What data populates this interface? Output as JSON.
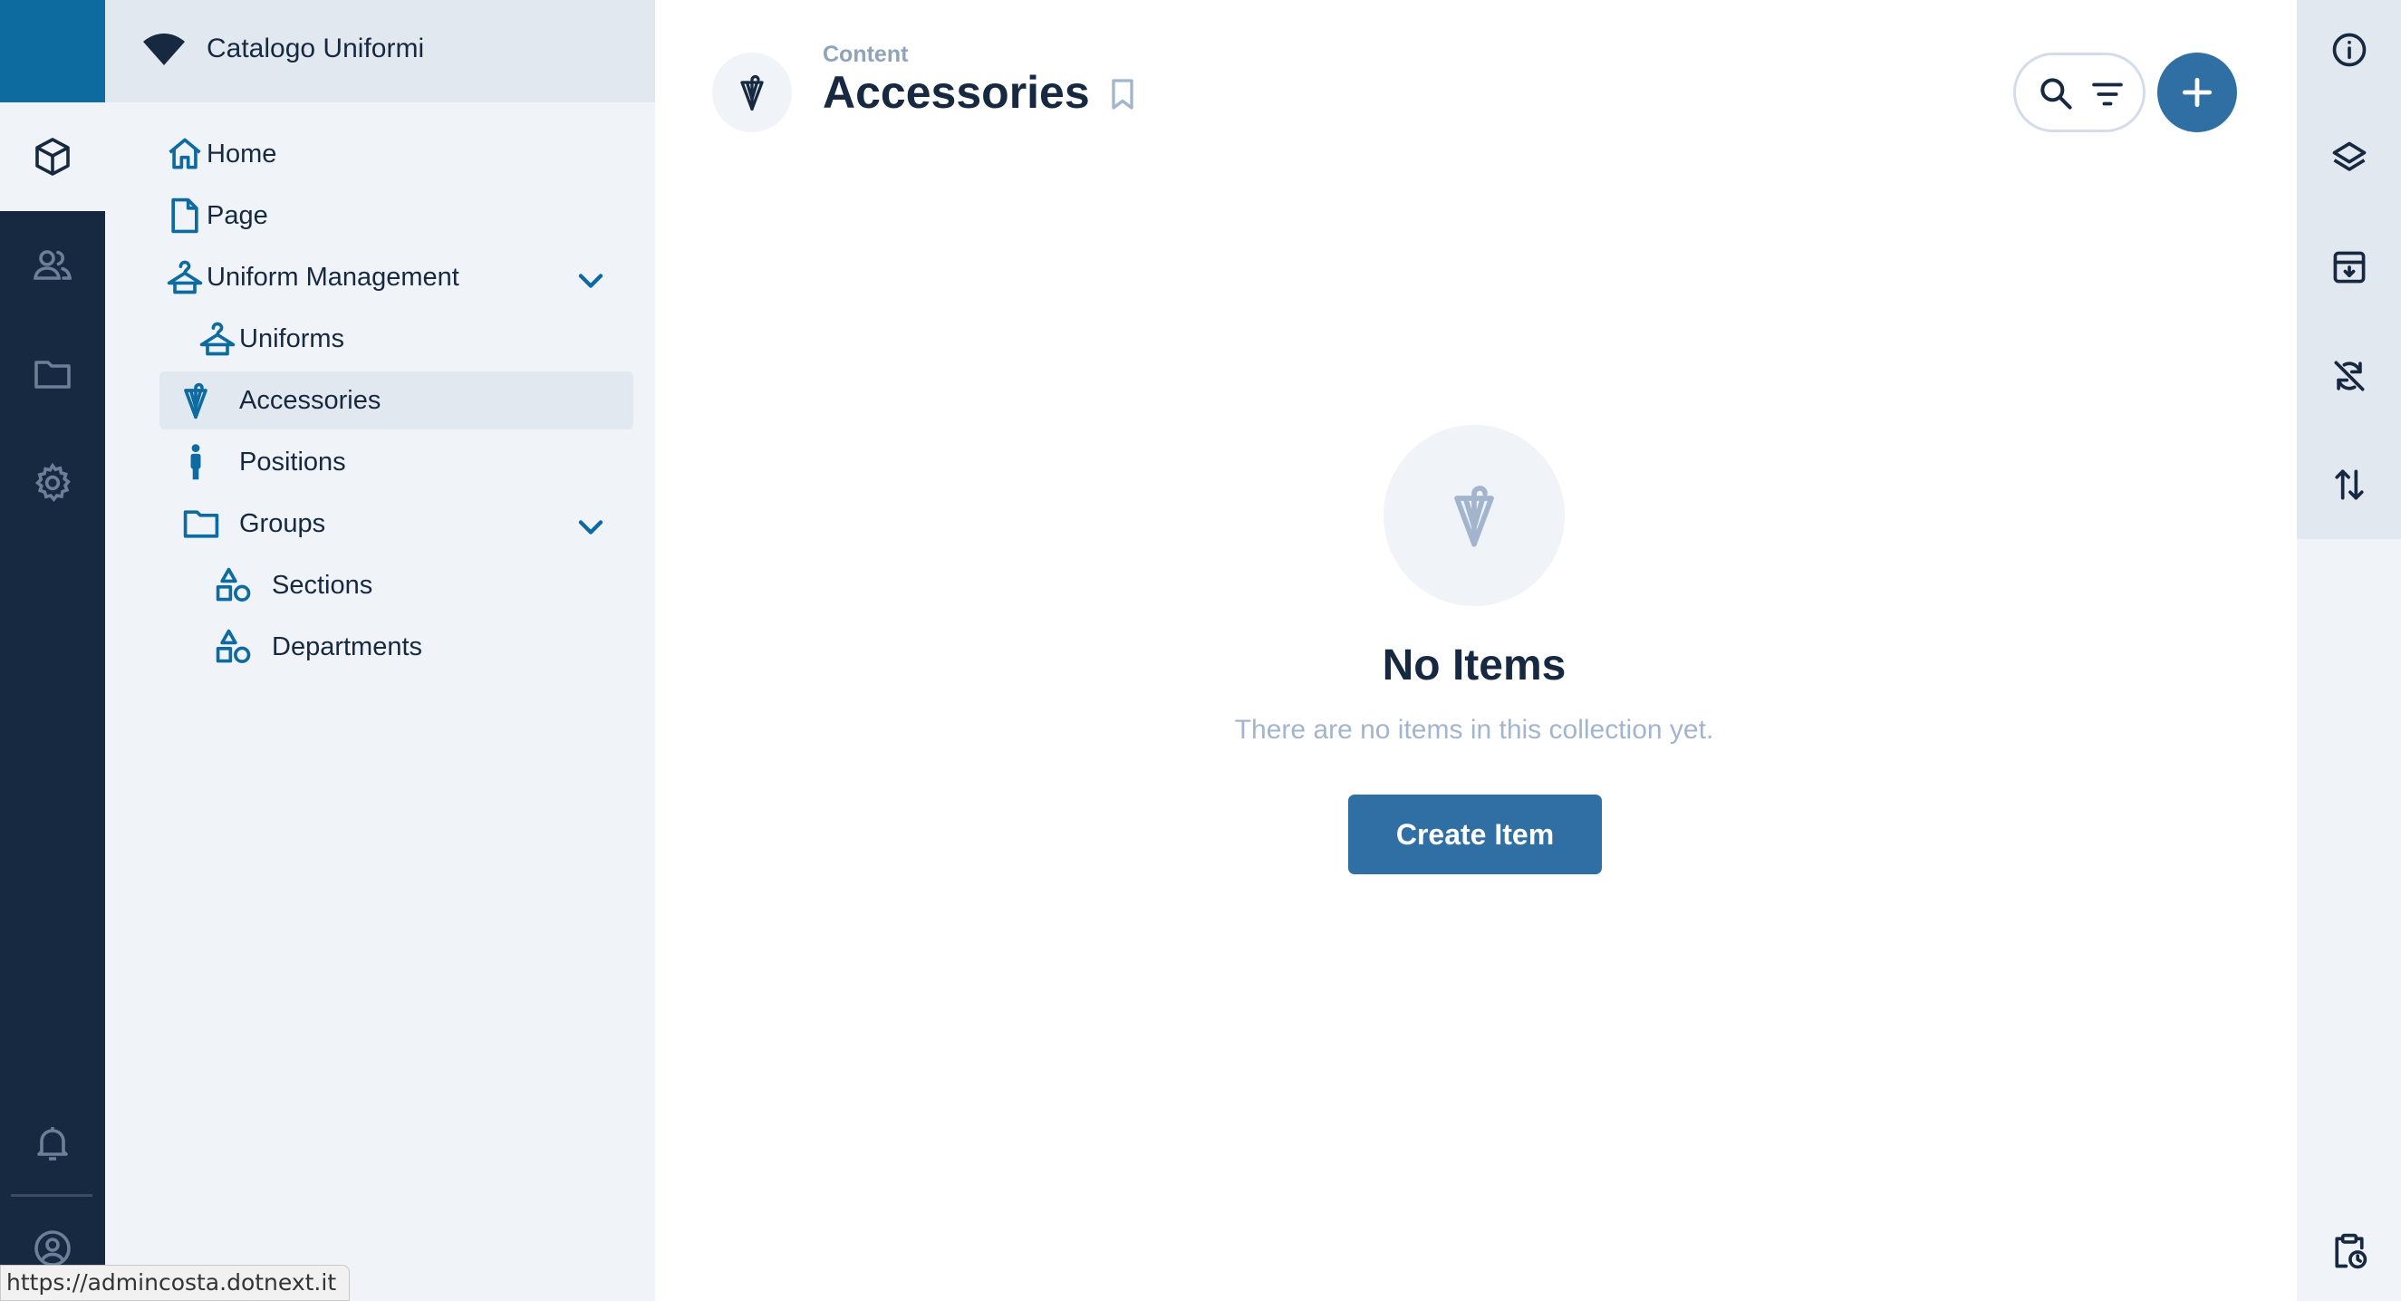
{
  "project": {
    "name": "Catalogo Uniformi"
  },
  "navigation": {
    "items": [
      {
        "label": "Home",
        "icon": "home-icon"
      },
      {
        "label": "Page",
        "icon": "page-icon"
      },
      {
        "label": "Uniform Management",
        "icon": "hanger-icon",
        "expanded": true
      },
      {
        "label": "Uniforms",
        "icon": "hanger-icon"
      },
      {
        "label": "Accessories",
        "icon": "umbrella-icon",
        "active": true
      },
      {
        "label": "Positions",
        "icon": "person-icon"
      },
      {
        "label": "Groups",
        "icon": "folder-icon",
        "expanded": true
      },
      {
        "label": "Sections",
        "icon": "shapes-icon"
      },
      {
        "label": "Departments",
        "icon": "shapes-icon"
      }
    ]
  },
  "header": {
    "breadcrumb": "Content",
    "title": "Accessories"
  },
  "empty_state": {
    "title": "No Items",
    "text": "There are no items in this collection yet.",
    "button_label": "Create Item"
  },
  "status_bar": {
    "url": "https://admincosta.dotnext.it"
  },
  "colors": {
    "accent": "#2f6fa3",
    "brand": "#0e6ba0",
    "module_bar": "#172940",
    "nav_background": "#f0f4f9",
    "nav_icon": "#0e6ba0"
  }
}
